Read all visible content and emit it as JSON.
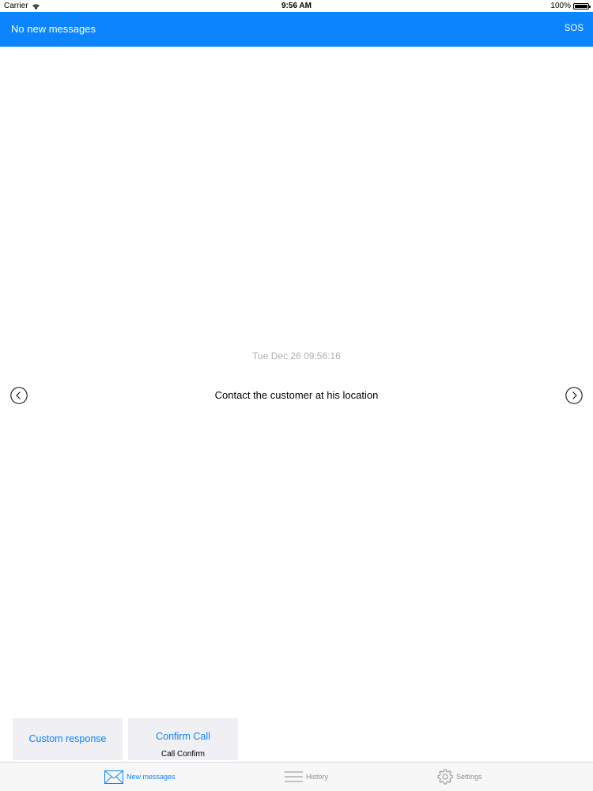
{
  "status_bar": {
    "carrier": "Carrier",
    "time": "9:56 AM",
    "battery": "100%",
    "wifi_icon": "wifi-icon",
    "battery_icon": "battery-icon"
  },
  "nav_bar": {
    "title": "No new messages",
    "sos_label": "SOS",
    "color": "#0b84fe"
  },
  "message": {
    "timestamp": "Tue Dec 26 09:56:16",
    "text": "Contact the customer at his location",
    "prev_icon": "chevron-left-circle-icon",
    "next_icon": "chevron-right-circle-icon"
  },
  "actions": {
    "custom_response_label": "Custom response",
    "confirm_call_label": "Confirm Call",
    "confirm_call_sublabel": "Call Confirm"
  },
  "tab_bar": {
    "tabs": [
      {
        "label": "New messages",
        "icon": "envelope-icon",
        "active": true
      },
      {
        "label": "History",
        "icon": "list-icon",
        "active": false
      },
      {
        "label": "Settings",
        "icon": "gear-icon",
        "active": false
      }
    ]
  }
}
